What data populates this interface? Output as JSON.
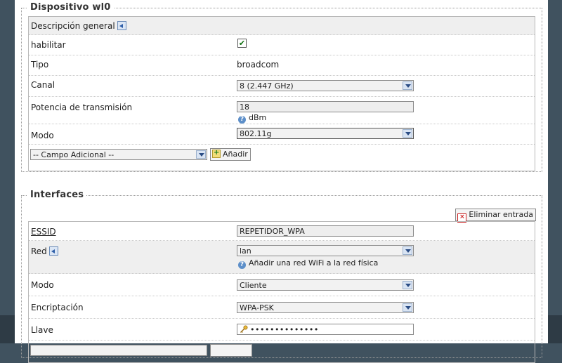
{
  "device_section": {
    "legend": "Dispositivo wl0",
    "general_label": "Descripción general",
    "enable_label": "habilitar",
    "enable_checked": true,
    "type_label": "Tipo",
    "type_value": "broadcom",
    "channel_label": "Canal",
    "channel_value": "8 (2.447 GHz)",
    "power_label": "Potencia de transmisión",
    "power_value": "18",
    "power_unit": "dBm",
    "mode_label": "Modo",
    "mode_value": "802.11g",
    "extra_field_value": "-- Campo Adicional --",
    "add_button": "Añadir"
  },
  "interfaces_section": {
    "legend": "Interfaces",
    "delete_button": "Eliminar entrada",
    "essid_label": "ESSID",
    "essid_value": "REPETIDOR_WPA",
    "network_label": "Red",
    "network_value": "lan",
    "network_hint": "Añadir una red WiFi a la red física",
    "mode_label": "Modo",
    "mode_value": "Cliente",
    "encryption_label": "Encriptación",
    "encryption_value": "WPA-PSK",
    "key_label": "Llave",
    "key_value": "••••••••••••••"
  }
}
